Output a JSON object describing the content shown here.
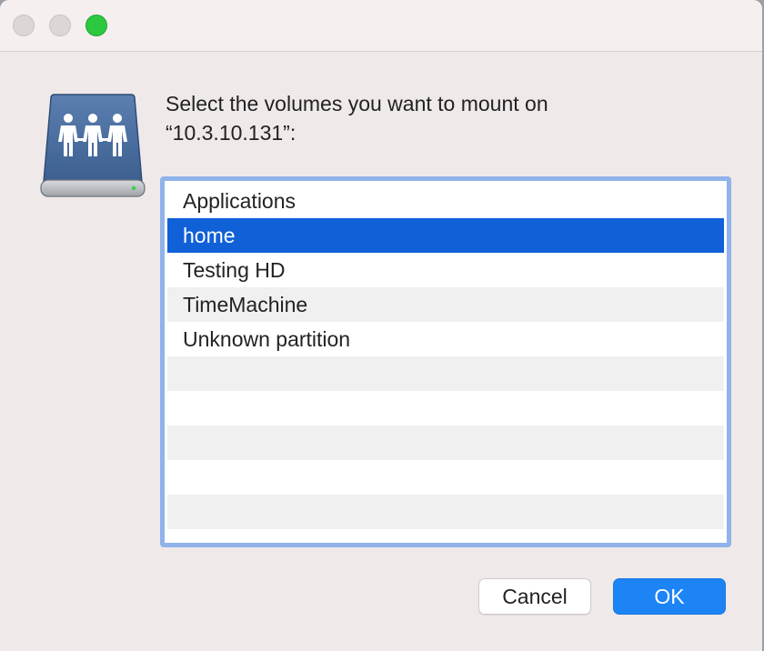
{
  "window": {
    "accent_color": "#1060d8",
    "traffic_lights": [
      "close",
      "minimize",
      "zoom"
    ]
  },
  "dialog": {
    "icon": "network-server-icon",
    "prompt_line1": "Select the volumes you want to mount on",
    "prompt_line2": "“10.3.10.131”:"
  },
  "volumes": {
    "items": [
      "Applications",
      "home",
      "Testing HD",
      "TimeMachine",
      "Unknown partition"
    ],
    "selected": "home"
  },
  "buttons": {
    "cancel_label": "Cancel",
    "ok_label": "OK"
  }
}
